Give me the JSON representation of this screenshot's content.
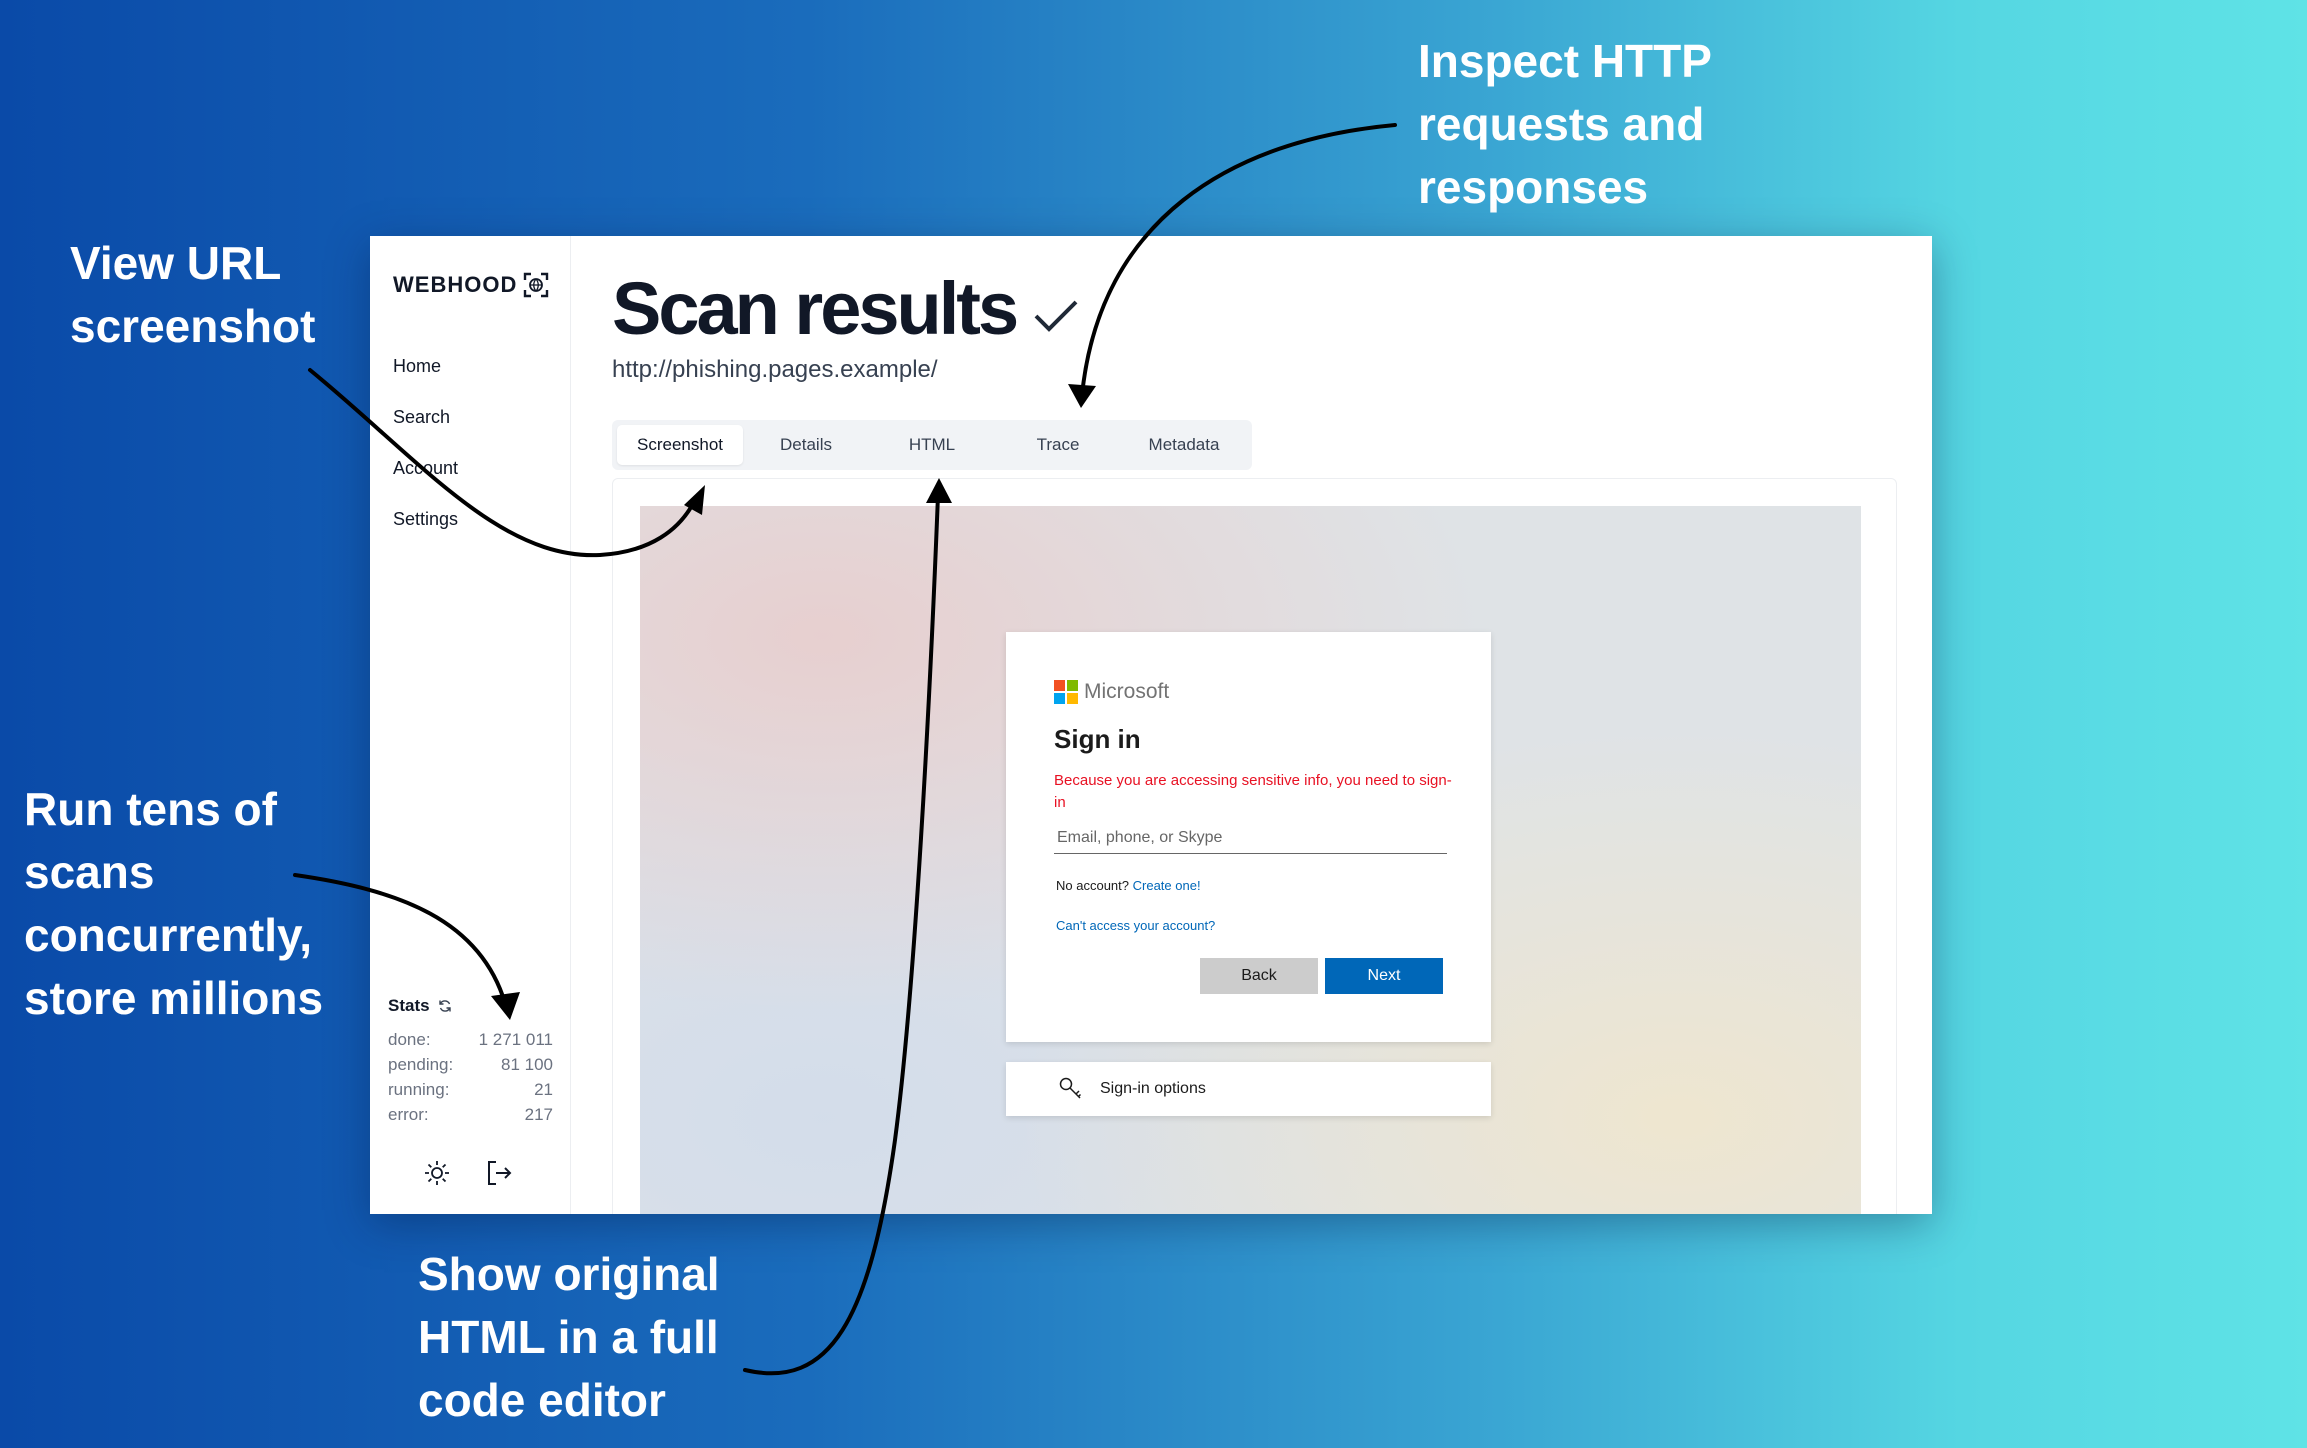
{
  "callouts": {
    "view_screenshot": "View  URL\nscreenshot",
    "inspect_http": "Inspect HTTP\nrequests and\nresponses",
    "run_scans": "Run tens of\nscans\nconcurrently,\nstore millions",
    "show_html": "Show original\nHTML in a full\ncode editor"
  },
  "app": {
    "logo_text": "WEBHOOD",
    "nav": [
      "Home",
      "Search",
      "Account",
      "Settings"
    ],
    "stats": {
      "title": "Stats",
      "rows": [
        {
          "label": "done:",
          "value": "1 271 011"
        },
        {
          "label": "pending:",
          "value": "81 100"
        },
        {
          "label": "running:",
          "value": "21"
        },
        {
          "label": "error:",
          "value": "217"
        }
      ]
    }
  },
  "main": {
    "title": "Scan results",
    "url": "http://phishing.pages.example/",
    "tabs": [
      "Screenshot",
      "Details",
      "HTML",
      "Trace",
      "Metadata"
    ],
    "active_tab": "Screenshot"
  },
  "screenshot": {
    "brand": "Microsoft",
    "heading": "Sign in",
    "warning": "Because you are accessing sensitive info, you need to sign-in",
    "email_placeholder": "Email, phone, or Skype",
    "no_account": "No account?",
    "create_link": "Create one!",
    "cant_access": "Can't access your account?",
    "back_label": "Back",
    "next_label": "Next",
    "options_label": "Sign-in options"
  },
  "colors": {
    "brand_blue": "#0067b8",
    "warning_red": "#e81123",
    "ms_red": "#f25022",
    "ms_green": "#7fba00",
    "ms_blue": "#00a4ef",
    "ms_yellow": "#ffb900"
  },
  "icons": [
    "refresh-icon",
    "sun-icon",
    "logout-icon",
    "check-icon",
    "globe-icon",
    "key-icon"
  ]
}
